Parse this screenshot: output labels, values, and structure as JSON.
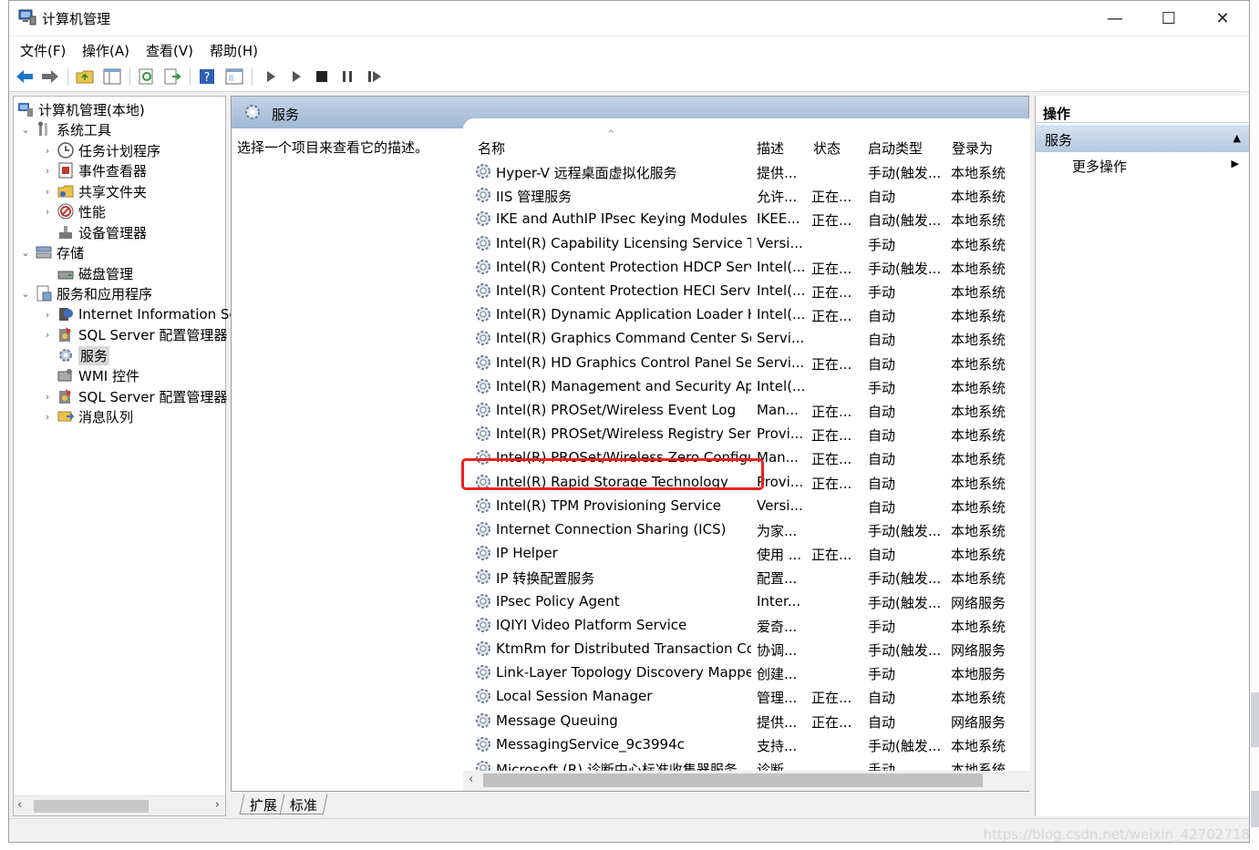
{
  "window": {
    "title": "计算机管理",
    "controls": {
      "minimize": "—",
      "maximize": "☐",
      "close": "✕"
    }
  },
  "menu": [
    "文件(F)",
    "操作(A)",
    "查看(V)",
    "帮助(H)"
  ],
  "toolbar": {
    "buttons": [
      "back-icon",
      "forward-icon",
      "up-folder-icon",
      "show-hide-tree-icon",
      "refresh-icon",
      "export-list-icon",
      "help-icon",
      "properties-icon",
      "start-service-icon",
      "start-service-alt-icon",
      "stop-service-icon",
      "pause-service-icon",
      "restart-service-icon"
    ]
  },
  "tree": {
    "root": "计算机管理(本地)",
    "system_tools": "系统工具",
    "task_scheduler": "任务计划程序",
    "event_viewer": "事件查看器",
    "shared_folders": "共享文件夹",
    "performance": "性能",
    "device_manager": "设备管理器",
    "storage": "存储",
    "disk_management": "磁盘管理",
    "services_apps": "服务和应用程序",
    "iis": "Internet Information Se",
    "sql_config_1": "SQL Server 配置管理器",
    "services": "服务",
    "wmi": "WMI 控件",
    "sql_config_2": "SQL Server 配置管理器",
    "message_queue": "消息队列"
  },
  "center": {
    "header": "服务",
    "description_hint": "选择一个项目来查看它的描述。",
    "columns": {
      "name": "名称",
      "description": "描述",
      "status": "状态",
      "startup": "启动类型",
      "logon": "登录为"
    },
    "rows": [
      {
        "name": "Hyper-V 远程桌面虚拟化服务",
        "description": "提供...",
        "status": "",
        "startup": "手动(触发...",
        "logon": "本地系统"
      },
      {
        "name": "IIS 管理服务",
        "description": "允许...",
        "status": "正在...",
        "startup": "自动",
        "logon": "本地系统"
      },
      {
        "name": "IKE and AuthIP IPsec Keying Modules",
        "description": "IKEE...",
        "status": "正在...",
        "startup": "自动(触发...",
        "logon": "本地系统"
      },
      {
        "name": "Intel(R) Capability Licensing Service TC...",
        "description": "Versi...",
        "status": "",
        "startup": "手动",
        "logon": "本地系统"
      },
      {
        "name": "Intel(R) Content Protection HDCP Serv...",
        "description": "Intel(...",
        "status": "正在...",
        "startup": "手动(触发...",
        "logon": "本地系统"
      },
      {
        "name": "Intel(R) Content Protection HECI Service",
        "description": "Intel(...",
        "status": "正在...",
        "startup": "手动",
        "logon": "本地系统"
      },
      {
        "name": "Intel(R) Dynamic Application Loader H...",
        "description": "Intel(...",
        "status": "正在...",
        "startup": "自动",
        "logon": "本地系统"
      },
      {
        "name": "Intel(R) Graphics Command Center Ser...",
        "description": "Servi...",
        "status": "",
        "startup": "自动",
        "logon": "本地系统"
      },
      {
        "name": "Intel(R) HD Graphics Control Panel Ser...",
        "description": "Servi...",
        "status": "正在...",
        "startup": "自动",
        "logon": "本地系统"
      },
      {
        "name": "Intel(R) Management and Security App...",
        "description": "Intel(...",
        "status": "",
        "startup": "手动",
        "logon": "本地系统"
      },
      {
        "name": "Intel(R) PROSet/Wireless Event Log",
        "description": "Man...",
        "status": "正在...",
        "startup": "自动",
        "logon": "本地系统"
      },
      {
        "name": "Intel(R) PROSet/Wireless Registry Serv...",
        "description": "Provi...",
        "status": "正在...",
        "startup": "自动",
        "logon": "本地系统"
      },
      {
        "name": "Intel(R) PROSet/Wireless Zero Configu...",
        "description": "Man...",
        "status": "正在...",
        "startup": "自动",
        "logon": "本地系统"
      },
      {
        "name": "Intel(R) Rapid Storage Technology",
        "description": "Provi...",
        "status": "正在...",
        "startup": "自动",
        "logon": "本地系统"
      },
      {
        "name": "Intel(R) TPM Provisioning Service",
        "description": "Versi...",
        "status": "",
        "startup": "自动",
        "logon": "本地系统"
      },
      {
        "name": "Internet Connection Sharing (ICS)",
        "description": "为家...",
        "status": "",
        "startup": "手动(触发...",
        "logon": "本地系统"
      },
      {
        "name": "IP Helper",
        "description": "使用 ...",
        "status": "正在...",
        "startup": "自动",
        "logon": "本地系统"
      },
      {
        "name": "IP 转换配置服务",
        "description": "配置...",
        "status": "",
        "startup": "手动(触发...",
        "logon": "本地系统"
      },
      {
        "name": "IPsec Policy Agent",
        "description": "Inter...",
        "status": "",
        "startup": "手动(触发...",
        "logon": "网络服务"
      },
      {
        "name": "IQIYI Video Platform Service",
        "description": "爱奇...",
        "status": "",
        "startup": "手动",
        "logon": "本地系统"
      },
      {
        "name": "KtmRm for Distributed Transaction Co...",
        "description": "协调...",
        "status": "",
        "startup": "手动(触发...",
        "logon": "网络服务"
      },
      {
        "name": "Link-Layer Topology Discovery Mapper",
        "description": "创建...",
        "status": "",
        "startup": "手动",
        "logon": "本地服务"
      },
      {
        "name": "Local Session Manager",
        "description": "管理...",
        "status": "正在...",
        "startup": "自动",
        "logon": "本地系统"
      },
      {
        "name": "Message Queuing",
        "description": "提供...",
        "status": "正在...",
        "startup": "自动",
        "logon": "网络服务"
      },
      {
        "name": "MessagingService_9c3994c",
        "description": "支持...",
        "status": "",
        "startup": "手动(触发...",
        "logon": "本地系统"
      },
      {
        "name": "Microsoft (R) 诊断中心标准收集器服务",
        "description": "诊断...",
        "status": "",
        "startup": "手动",
        "logon": "本地系统"
      }
    ],
    "tabs": [
      "扩展",
      "标准"
    ]
  },
  "actions": {
    "title": "操作",
    "section": "服务",
    "more": "更多操作"
  },
  "watermark": "https://blog.csdn.net/weixin_42702718",
  "colors": {
    "highlight_box": "#e8231f",
    "pane_header": "#9fb6d3",
    "selected_tree_item": "#d9d9d9"
  }
}
